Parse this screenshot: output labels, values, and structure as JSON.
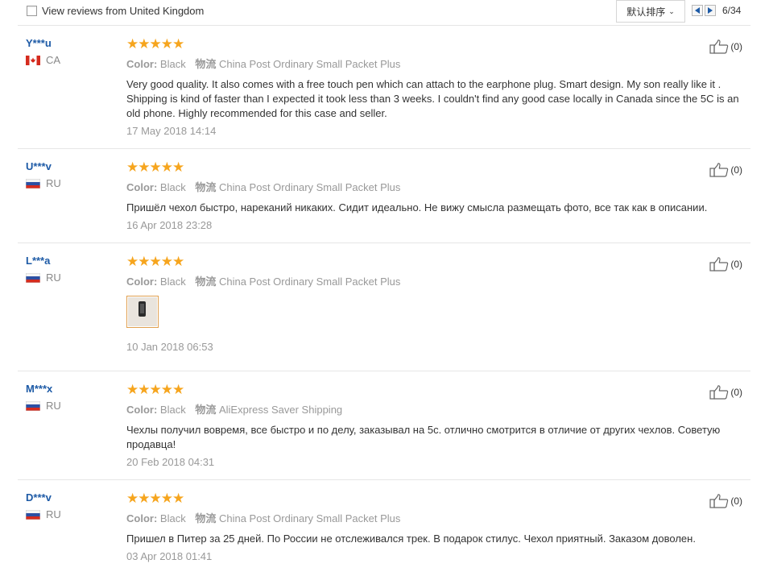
{
  "toolbar": {
    "filter_label": "View reviews from United Kingdom",
    "sort_label": "默认排序",
    "sort_icon": "chevron-down-icon",
    "page_text": "6/34"
  },
  "colors": {
    "username": "#1d5aa6",
    "star": "#f6a51e",
    "meta": "#999999",
    "divider": "#e6e6e6"
  },
  "reviews": [
    {
      "user": "Y***u",
      "country": "CA",
      "stars": "★★★★★",
      "color_label": "Color:",
      "color_value": "Black",
      "shipping_label": "物流",
      "shipping_value": "China Post Ordinary Small Packet Plus",
      "text": "Very good quality. It also comes with a free touch pen which can attach to the earphone plug. Smart design. My son really like it . Shipping is kind of faster than I expected it took less than 3 weeks. I couldn't find any good case locally in Canada since the 5C is an old phone. Highly recommended for this case and seller.",
      "date": "17 May 2018 14:14",
      "likes": "(0)"
    },
    {
      "user": "U***v",
      "country": "RU",
      "stars": "★★★★★",
      "color_label": "Color:",
      "color_value": "Black",
      "shipping_label": "物流",
      "shipping_value": "China Post Ordinary Small Packet Plus",
      "text": "Пришёл чехол быстро, нареканий никаких. Сидит идеально. Не вижу смысла размещать фото, все так как в описании.",
      "date": "16 Apr 2018 23:28",
      "likes": "(0)"
    },
    {
      "user": "L***a",
      "country": "RU",
      "stars": "★★★★★",
      "color_label": "Color:",
      "color_value": "Black",
      "shipping_label": "物流",
      "shipping_value": "China Post Ordinary Small Packet Plus",
      "text": "",
      "date": "10 Jan 2018 06:53",
      "likes": "(0)"
    },
    {
      "user": "M***x",
      "country": "RU",
      "stars": "★★★★★",
      "color_label": "Color:",
      "color_value": "Black",
      "shipping_label": "物流",
      "shipping_value": "AliExpress Saver Shipping",
      "text": "Чехлы получил вовремя, все быстро и по делу, заказывал на 5с. отлично смотрится в отличие от других чехлов. Советую продавца!",
      "date": "20 Feb 2018 04:31",
      "likes": "(0)"
    },
    {
      "user": "D***v",
      "country": "RU",
      "stars": "★★★★★",
      "color_label": "Color:",
      "color_value": "Black",
      "shipping_label": "物流",
      "shipping_value": "China Post Ordinary Small Packet Plus",
      "text": "Пришел в Питер за 25 дней. По России не отслеживался трек. В подарок стилус. Чехол приятный. Заказом доволен.",
      "date": "03 Apr 2018 01:41",
      "likes": "(0)"
    }
  ]
}
